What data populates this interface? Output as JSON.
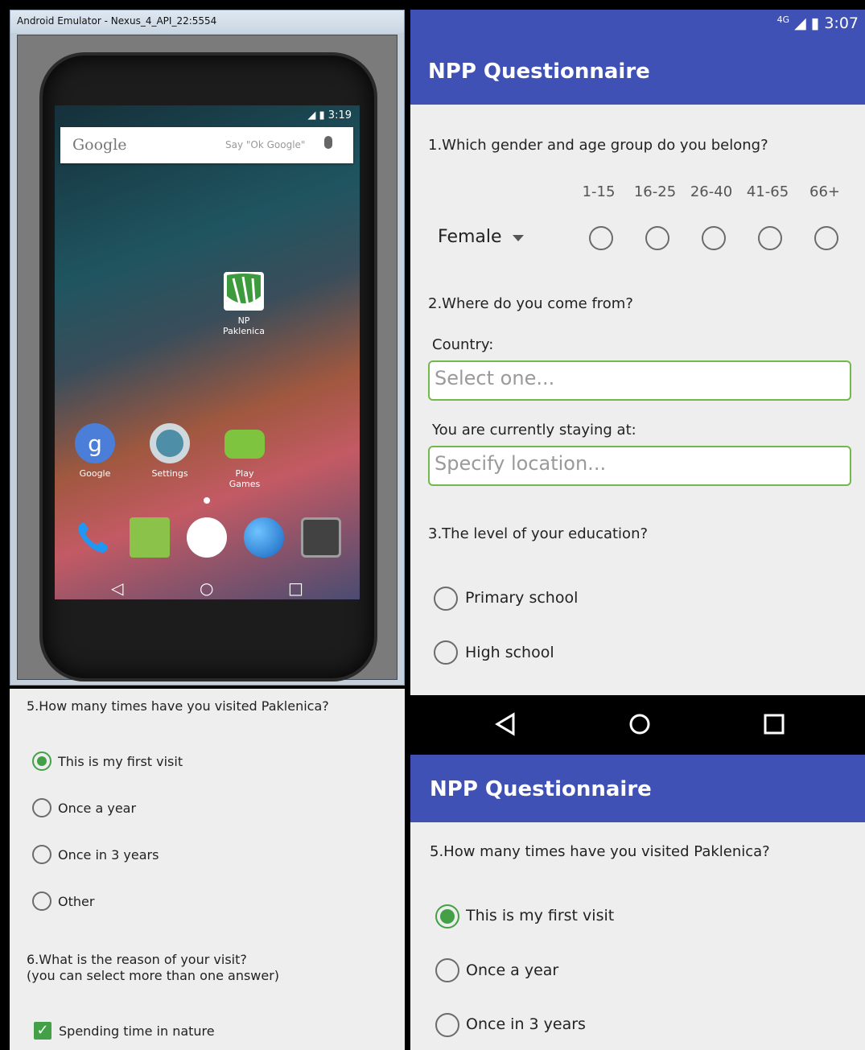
{
  "emulator": {
    "window_title": "Android Emulator - Nexus_4_API_22:5554",
    "status_time": "3:19",
    "search_brand": "Google",
    "search_hint": "Say \"Ok Google\"",
    "apps": [
      {
        "label": "NP Paklenica"
      },
      {
        "label": "Google"
      },
      {
        "label": "Settings"
      },
      {
        "label": "Play Games"
      }
    ]
  },
  "status": {
    "network": "4G",
    "time": "3:07"
  },
  "app_title": "NPP Questionnaire",
  "q1": {
    "text": "1.Which gender and age group do you belong?",
    "gender_selected": "Female",
    "age_groups": [
      "1-15",
      "16-25",
      "26-40",
      "41-65",
      "66+"
    ]
  },
  "q2": {
    "text": "2.Where do you come from?",
    "country_label": "Country:",
    "country_placeholder": "Select one...",
    "staying_label": "You are currently staying at:",
    "staying_placeholder": "Specify location..."
  },
  "q3": {
    "text": "3.The level of your education?",
    "options": [
      "Primary school",
      "High school"
    ]
  },
  "q5": {
    "text": "5.How many times have you visited Paklenica?",
    "options": [
      "This is my first visit",
      "Once a year",
      "Once in 3 years",
      "Other"
    ],
    "selected_index": 0
  },
  "q6": {
    "text_line1": "6.What is the reason of your visit?",
    "text_line2": "(you can select more than one answer)",
    "options": [
      "Spending time in nature"
    ],
    "checked": [
      true
    ]
  },
  "colors": {
    "primary": "#3f51b5",
    "accent": "#43a047",
    "field_border": "#72b84b"
  }
}
